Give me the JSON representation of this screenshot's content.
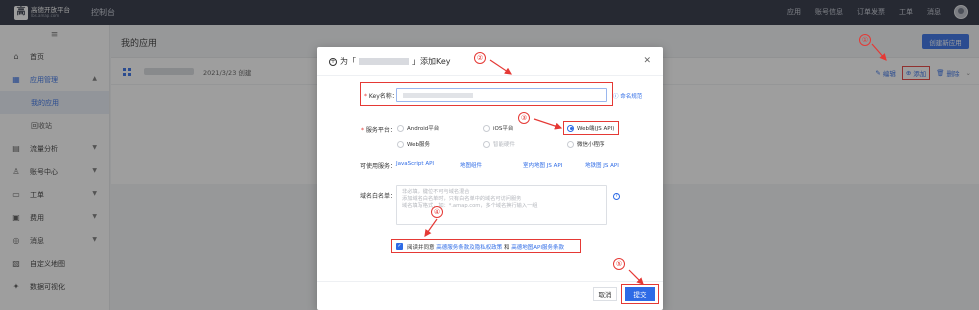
{
  "topbar": {
    "logo_text": "高德开放平台",
    "logo_sub": "lbs.amap.com",
    "console_label": "控制台",
    "nav": [
      "应用",
      "账号信息",
      "订单发票",
      "工单",
      "消息"
    ]
  },
  "sidebar": {
    "items": [
      {
        "label": "首页",
        "icon": "home-icon"
      },
      {
        "label": "应用管理",
        "icon": "app-grid-icon"
      },
      {
        "label": "我的应用",
        "icon": ""
      },
      {
        "label": "回收站",
        "icon": ""
      },
      {
        "label": "流量分析",
        "icon": "chart-icon"
      },
      {
        "label": "账号中心",
        "icon": "user-icon"
      },
      {
        "label": "工单",
        "icon": "ticket-icon"
      },
      {
        "label": "费用",
        "icon": "fee-icon"
      },
      {
        "label": "消息",
        "icon": "message-icon"
      },
      {
        "label": "自定义地图",
        "icon": "map-icon"
      },
      {
        "label": "数据可视化",
        "icon": "visual-icon"
      }
    ]
  },
  "main": {
    "page_title": "我的应用",
    "create_button": "创建新应用",
    "app": {
      "date": "2021/3/23 创建",
      "actions": {
        "edit": "编辑",
        "add": "添加",
        "delete": "删除"
      }
    }
  },
  "modal": {
    "title_prefix": "为「",
    "title_suffix": "」添加Key",
    "key_name_label": "Key名称：",
    "naming_rule_link": "命名规范",
    "platform_label": "服务平台：",
    "platforms": [
      {
        "label": "Android平台",
        "checked": false,
        "disabled": false
      },
      {
        "label": "iOS平台",
        "checked": false,
        "disabled": false
      },
      {
        "label": "Web端(JS API)",
        "checked": true,
        "disabled": false
      },
      {
        "label": "Web服务",
        "checked": false,
        "disabled": false
      },
      {
        "label": "智能硬件",
        "checked": false,
        "disabled": true
      },
      {
        "label": "微信小程序",
        "checked": false,
        "disabled": false
      }
    ],
    "available_label": "可使用服务：",
    "services": [
      "JavaScript API",
      "地图组件",
      "室内地图 JS API",
      "地铁图 JS API"
    ],
    "whitelist_label": "域名白名单：",
    "whitelist_placeholder": [
      "非必填，键位不可与域名混合",
      "添加域名白名单时，只有白名单中的域名可访问服务",
      "域名填写格式，如：*.amap.com，多个域名换行输入一组"
    ],
    "agree_prefix": "阅读并同意",
    "agree_link1": "高德服务条款及隐私权政策",
    "agree_and": "和",
    "agree_link2": "高德地图API服务条款",
    "cancel_button": "取消",
    "submit_button": "提交"
  },
  "annotations": [
    "①",
    "②",
    "③",
    "④",
    "⑤"
  ],
  "colors": {
    "accent": "#2e6be6",
    "annotation": "#e53935",
    "topbar": "#252b3b"
  }
}
